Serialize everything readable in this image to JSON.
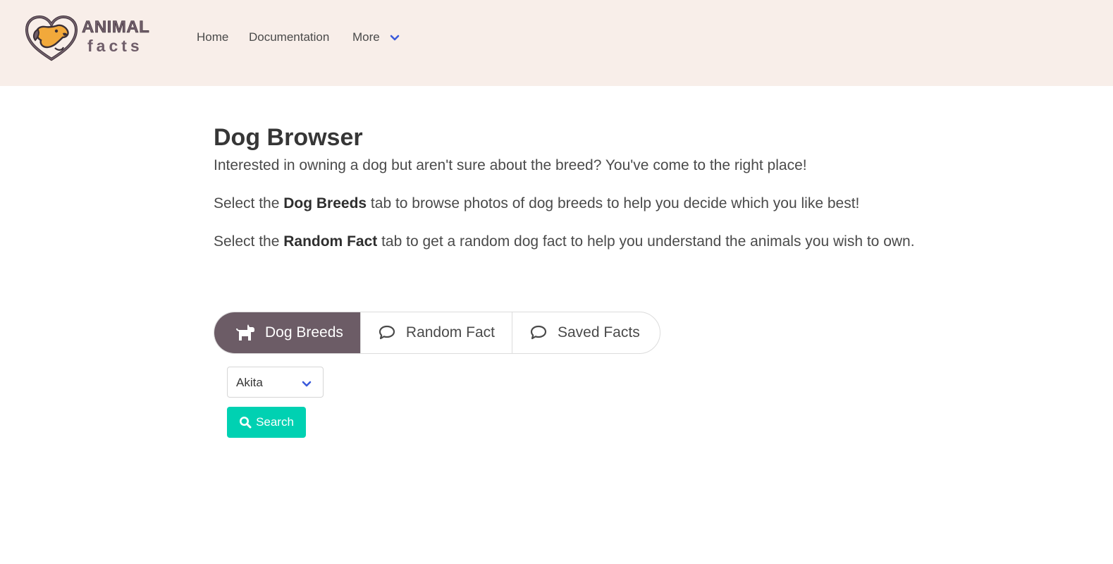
{
  "brand": {
    "logo_word1": "ANIMAL",
    "logo_word2": "facts",
    "colors": {
      "navbar_bg": "#f8eee9",
      "brand_purple": "#6c5c66",
      "dog_orange": "#f2a93b",
      "accent_blue": "#3b5bdb",
      "primary_teal": "#00d1b2"
    }
  },
  "nav": {
    "home": "Home",
    "documentation": "Documentation",
    "more": "More"
  },
  "main": {
    "title": "Dog Browser",
    "intro": "Interested in owning a dog but aren't sure about the breed? You've come to the right place!",
    "p2_before": "Select the ",
    "p2_bold": "Dog Breeds",
    "p2_after": " tab to browse photos of dog breeds to help you decide which you like best!",
    "p3_before": "Select the ",
    "p3_bold": "Random Fact",
    "p3_after": " tab to get a random dog fact to help you understand the animals you wish to own."
  },
  "tabs": [
    {
      "label": "Dog Breeds",
      "icon": "dog-icon",
      "active": true
    },
    {
      "label": "Random Fact",
      "icon": "speech-bubble-icon",
      "active": false
    },
    {
      "label": "Saved Facts",
      "icon": "speech-bubble-icon",
      "active": false
    }
  ],
  "breed_select": {
    "selected": "Akita",
    "icon": "chevron-down-icon"
  },
  "search_button": {
    "label": "Search",
    "icon": "search-icon"
  }
}
